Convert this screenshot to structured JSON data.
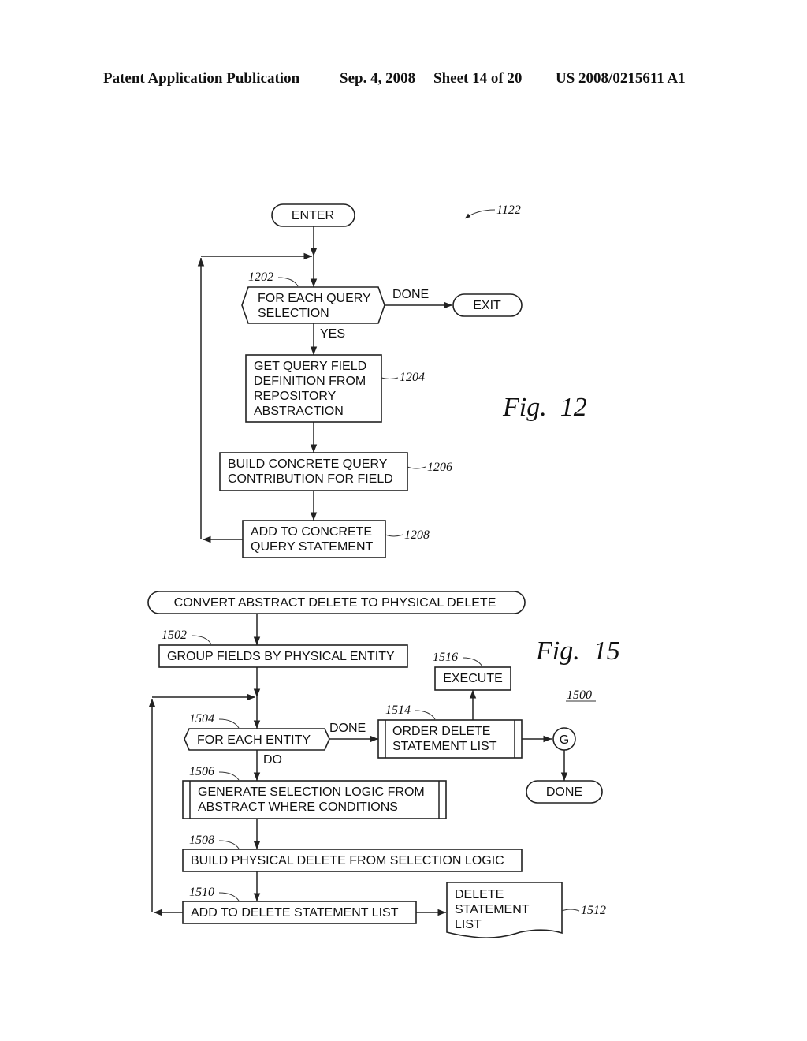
{
  "header": {
    "publication": "Patent Application Publication",
    "date": "Sep. 4, 2008",
    "sheet": "Sheet 14 of 20",
    "number": "US 2008/0215611 A1"
  },
  "fig12": {
    "figure_label": "Fig.  12",
    "ref_main": "1122",
    "enter": "ENTER",
    "exit": "EXIT",
    "loop": {
      "ref": "1202",
      "lines": [
        "FOR EACH QUERY",
        "SELECTION"
      ]
    },
    "done_label": "DONE",
    "yes_label": "YES",
    "step_1204": {
      "ref": "1204",
      "lines": [
        "GET QUERY FIELD",
        "DEFINITION FROM",
        "REPOSITORY",
        "ABSTRACTION"
      ]
    },
    "step_1206": {
      "ref": "1206",
      "lines": [
        "BUILD CONCRETE QUERY",
        "CONTRIBUTION FOR FIELD"
      ]
    },
    "step_1208": {
      "ref": "1208",
      "lines": [
        "ADD TO CONCRETE",
        "QUERY STATEMENT"
      ]
    }
  },
  "fig15": {
    "figure_label": "Fig.  15",
    "ref_main": "1500",
    "start": "CONVERT ABSTRACT DELETE TO PHYSICAL DELETE",
    "step_1502": {
      "ref": "1502",
      "text": "GROUP FIELDS BY PHYSICAL ENTITY"
    },
    "loop_1504": {
      "ref": "1504",
      "text": "FOR EACH ENTITY"
    },
    "done_label": "DONE",
    "do_label": "DO",
    "step_1506": {
      "ref": "1506",
      "lines": [
        "GENERATE SELECTION LOGIC FROM",
        "ABSTRACT WHERE CONDITIONS"
      ]
    },
    "step_1508": {
      "ref": "1508",
      "text": "BUILD PHYSICAL DELETE FROM SELECTION LOGIC"
    },
    "step_1510": {
      "ref": "1510",
      "text": "ADD TO DELETE STATEMENT LIST"
    },
    "doc_1512": {
      "ref": "1512",
      "lines": [
        "DELETE",
        "STATEMENT",
        "LIST"
      ]
    },
    "step_1514": {
      "ref": "1514",
      "lines": [
        "ORDER DELETE",
        "STATEMENT LIST"
      ]
    },
    "step_1516": {
      "ref": "1516",
      "text": "EXECUTE"
    },
    "connector": "G",
    "end": "DONE"
  }
}
